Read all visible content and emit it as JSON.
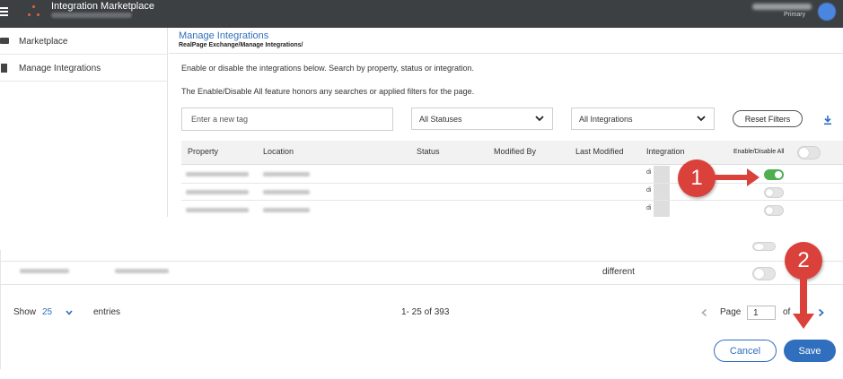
{
  "topbar": {
    "app_title": "Integration Marketplace",
    "user_role": "Primary",
    "icons": [
      "hamburger-menu-icon",
      "app-logo-icon",
      "user-avatar"
    ]
  },
  "sidebar": {
    "items": [
      {
        "label": "Marketplace",
        "icon": "store-icon"
      },
      {
        "label": "Manage Integrations",
        "icon": "building-icon"
      }
    ]
  },
  "page": {
    "title": "Manage Integrations",
    "breadcrumb": "RealPage Exchange/Manage Integrations/",
    "description_1": "Enable or disable the integrations below. Search by property, status or integration.",
    "description_2": "The Enable/Disable All feature honors any searches or applied filters for the page."
  },
  "filters": {
    "tag_placeholder": "Enter a new tag",
    "status_selected": "All Statuses",
    "integration_selected": "All Integrations",
    "reset_label": "Reset Filters"
  },
  "table": {
    "headers": [
      "Property",
      "Location",
      "Status",
      "Modified By",
      "Last Modified",
      "Integration"
    ],
    "enable_all_label": "Enable/Disable All",
    "enable_all_on": false,
    "rows": [
      {
        "integration": "di",
        "enabled": true
      },
      {
        "integration": "di",
        "enabled": false
      },
      {
        "integration": "di",
        "enabled": false
      }
    ],
    "lower_row": {
      "integration": "different",
      "enabled": false
    }
  },
  "pagination": {
    "show_label": "Show",
    "page_size": "25",
    "entries_label": "entries",
    "range": "1- 25 of 393",
    "page_label": "Page",
    "page_value": "1",
    "of_label": "of"
  },
  "actions": {
    "cancel_label": "Cancel",
    "save_label": "Save"
  },
  "annotations": {
    "callout_1": "1",
    "callout_2": "2",
    "color": "#d9413a"
  },
  "colors": {
    "topbar": "#3c4043",
    "accent": "#2f6fbe",
    "toggle_on": "#4caf50",
    "logo": "#e8613c"
  }
}
